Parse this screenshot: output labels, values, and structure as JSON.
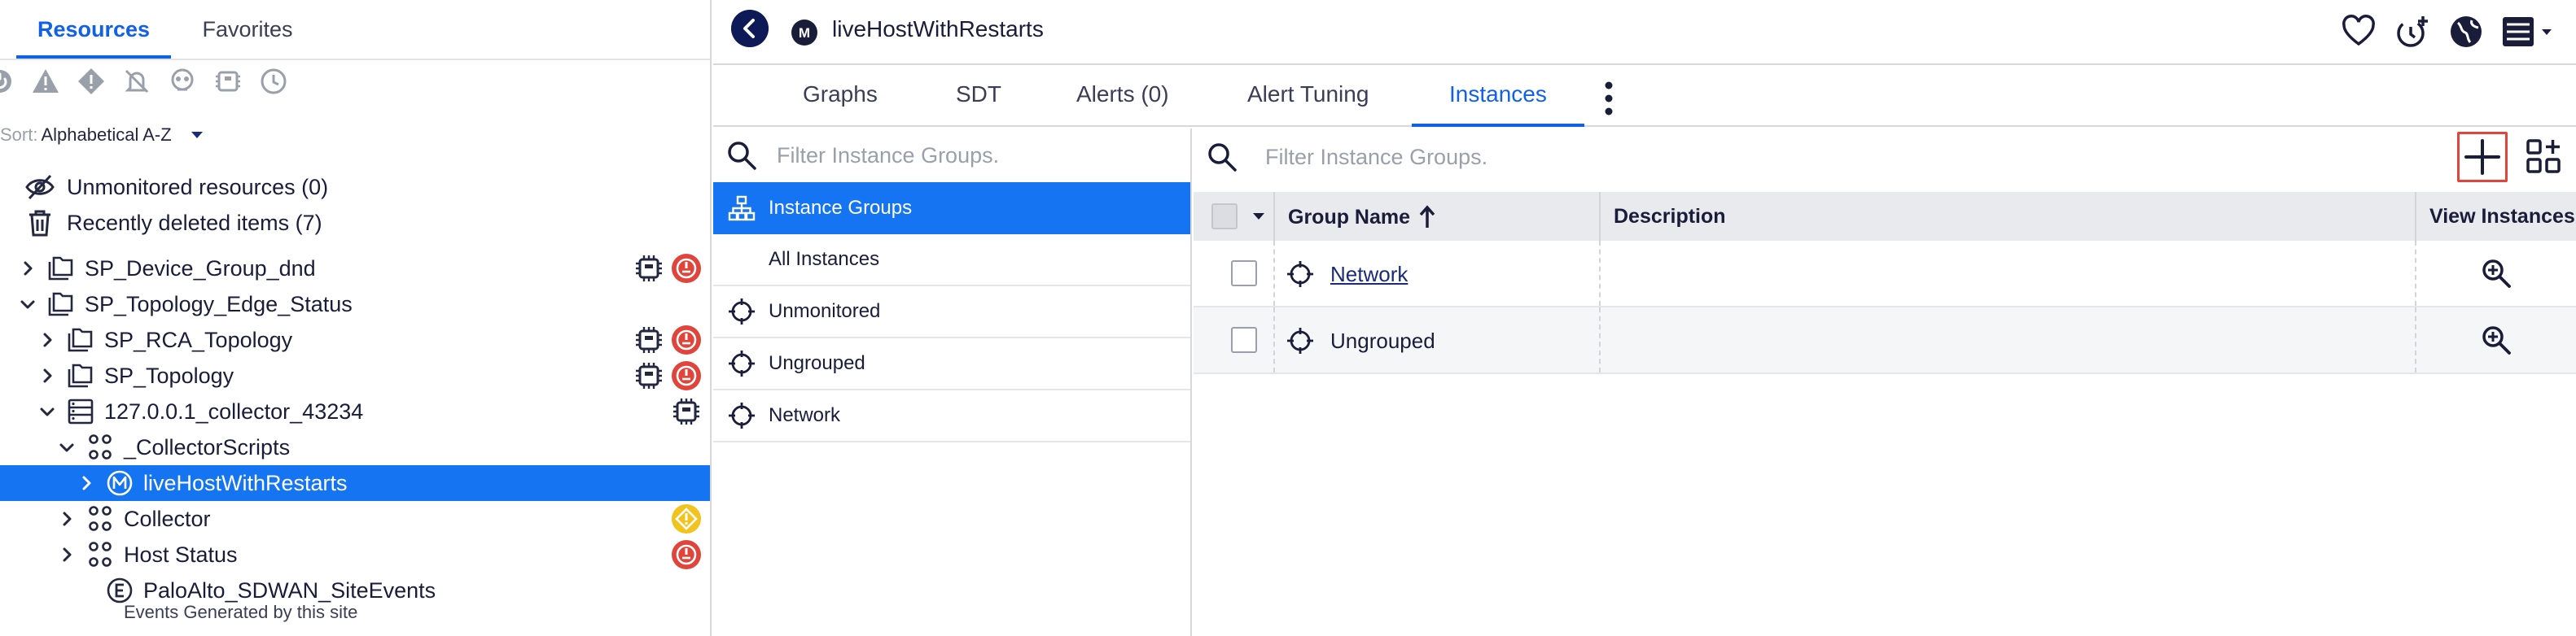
{
  "left_panel": {
    "tabs": [
      {
        "label": "Resources",
        "active": true
      },
      {
        "label": "Favorites",
        "active": false
      }
    ],
    "filter_icons": [
      "dead-icon",
      "warning-icon",
      "error-icon",
      "alert-off-icon",
      "skull-icon",
      "collector-icon",
      "clock-icon"
    ],
    "sort": {
      "prefix": "Sort:",
      "value": "Alphabetical A-Z"
    },
    "unmonitored": "Unmonitored resources (0)",
    "recently_deleted": "Recently deleted items (7)",
    "tree": [
      {
        "label": "SP_Device_Group_dnd",
        "indent": 0,
        "expanded": false,
        "icon": "folder-icon",
        "badges": [
          "collector-badge",
          "dead-badge"
        ]
      },
      {
        "label": "SP_Topology_Edge_Status",
        "indent": 0,
        "expanded": true,
        "icon": "folder-icon",
        "badges": []
      },
      {
        "label": "SP_RCA_Topology",
        "indent": 1,
        "expanded": false,
        "icon": "folder-icon",
        "badges": [
          "collector-badge",
          "dead-badge"
        ]
      },
      {
        "label": "SP_Topology",
        "indent": 1,
        "expanded": false,
        "icon": "folder-icon",
        "badges": [
          "collector-badge",
          "dead-badge"
        ]
      },
      {
        "label": "127.0.0.1_collector_43234",
        "indent": 1,
        "expanded": true,
        "icon": "server-icon",
        "badges": [
          "collector-badge"
        ]
      },
      {
        "label": "_CollectorScripts",
        "indent": 2,
        "expanded": true,
        "icon": "group-icon",
        "badges": []
      },
      {
        "label": "liveHostWithRestarts",
        "indent": 3,
        "expanded": false,
        "icon": "module-icon",
        "badges": [],
        "selected": true
      },
      {
        "label": "Collector",
        "indent": 2,
        "expanded": false,
        "icon": "group-icon",
        "badges": [
          "warning-badge"
        ]
      },
      {
        "label": "Host Status",
        "indent": 2,
        "expanded": false,
        "icon": "group-icon",
        "badges": [
          "dead-badge"
        ]
      },
      {
        "label": "PaloAlto_SDWAN_SiteEvents",
        "indent": 3,
        "expanded": null,
        "icon": "event-icon",
        "badges": []
      }
    ],
    "sub_text": "Events Generated by this site"
  },
  "topbar": {
    "title": "liveHostWithRestarts",
    "module_letter": "M",
    "icons": [
      "heart-icon",
      "add-schedule-icon",
      "globe-icon",
      "dashboard-menu-icon"
    ]
  },
  "subtabs": [
    {
      "label": "Graphs",
      "active": false
    },
    {
      "label": "SDT",
      "active": false
    },
    {
      "label": "Alerts (0)",
      "active": false
    },
    {
      "label": "Alert Tuning",
      "active": false
    },
    {
      "label": "Instances",
      "active": true
    }
  ],
  "group_list": {
    "search_placeholder": "Filter Instance Groups.",
    "items": [
      {
        "label": "Instance Groups",
        "icon": "hierarchy-icon",
        "selected": true
      },
      {
        "label": "All Instances",
        "icon": "",
        "selected": false
      },
      {
        "label": "Unmonitored",
        "icon": "crosshair-icon",
        "selected": false
      },
      {
        "label": "Ungrouped",
        "icon": "crosshair-icon",
        "selected": false
      },
      {
        "label": "Network",
        "icon": "crosshair-icon",
        "selected": false
      }
    ]
  },
  "table": {
    "search_placeholder": "Filter Instance Groups.",
    "columns": {
      "name": "Group Name",
      "description": "Description",
      "view": "View Instances"
    },
    "sort": "ascending",
    "rows": [
      {
        "name": "Network",
        "link": true,
        "description": ""
      },
      {
        "name": "Ungrouped",
        "link": false,
        "description": ""
      }
    ]
  },
  "colors": {
    "accent": "#1161e6",
    "selection": "#1574f2",
    "navy": "#0d1a57",
    "danger": "#e0443a",
    "warning": "#f2c31c"
  }
}
